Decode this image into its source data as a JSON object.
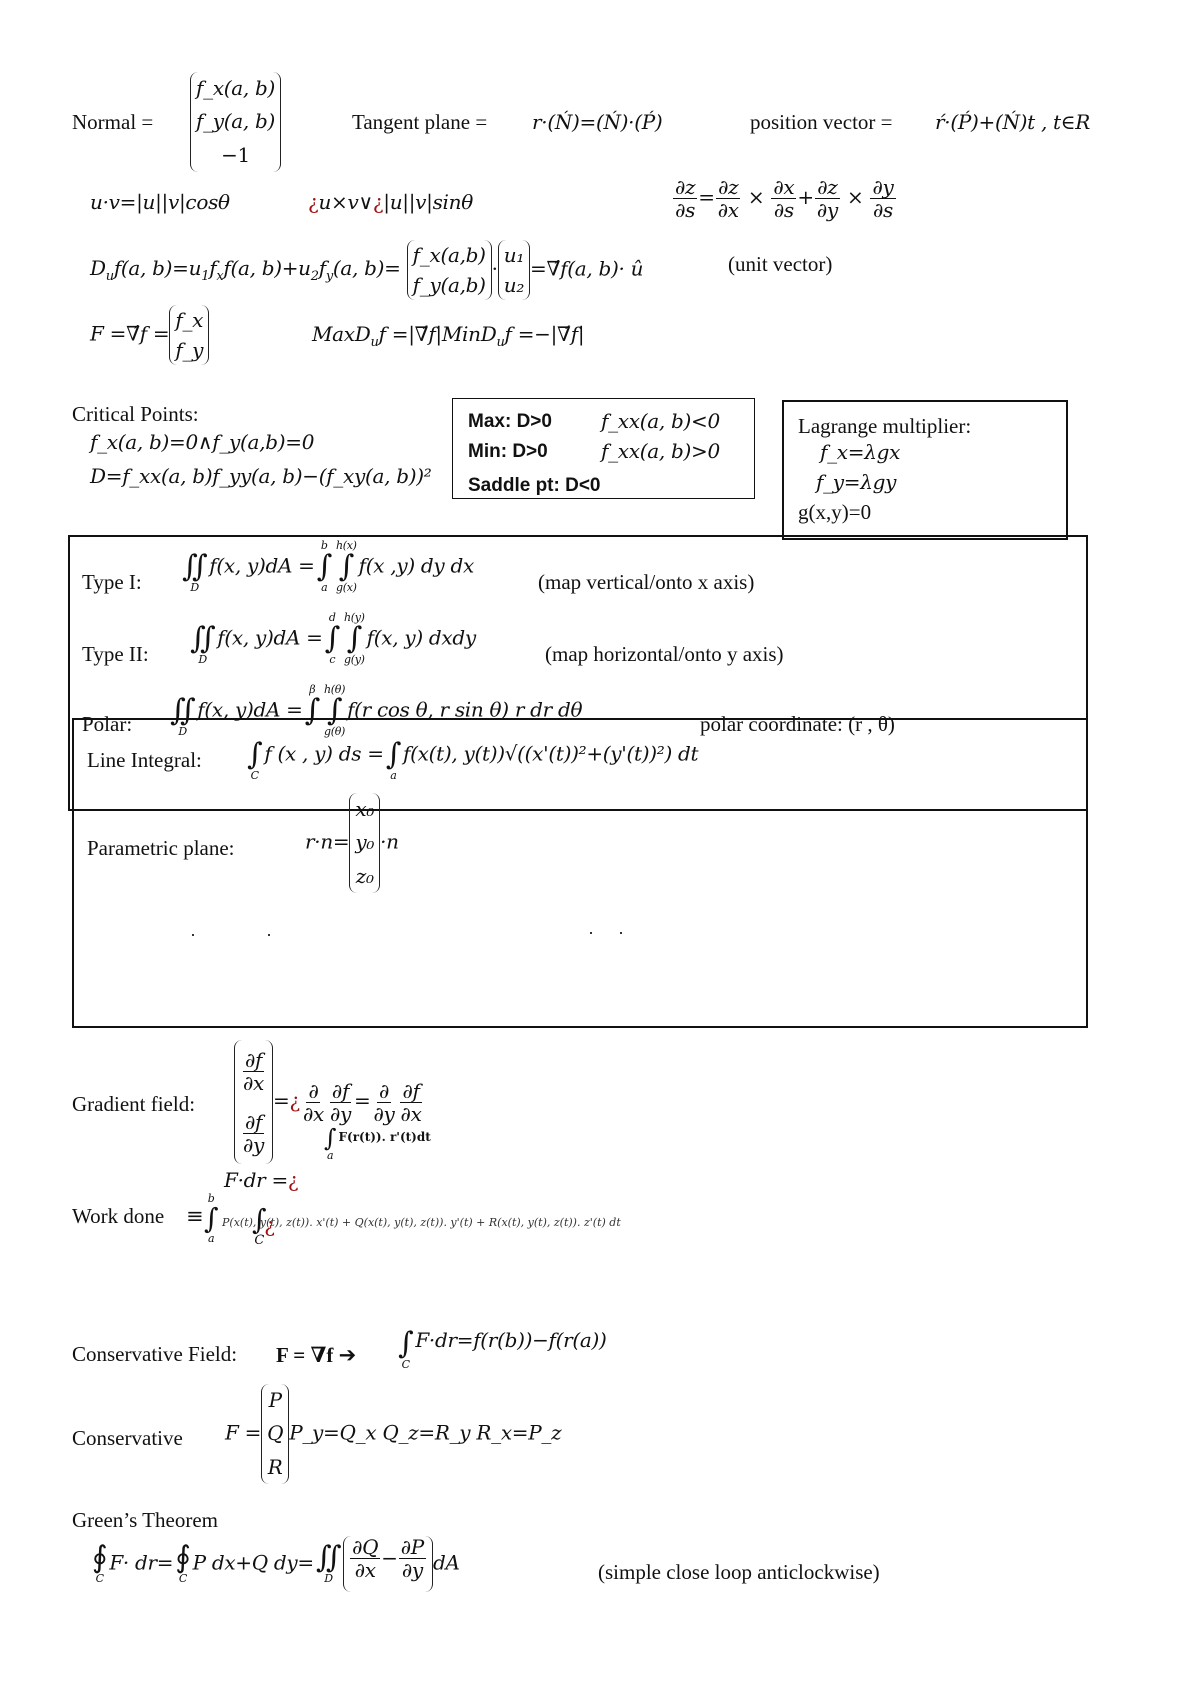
{
  "row1": {
    "normal_label": "Normal =",
    "normal_vector": [
      "f_x(a, b)",
      "f_y(a, b)",
      "−1"
    ],
    "tangent_label": "Tangent plane =",
    "tangent_expr": "r·(Ń)=(Ń)·(Ṕ)",
    "position_label": "position vector =",
    "position_expr": "ŕ·(Ṕ)+(Ń)t , t∈R"
  },
  "row2": {
    "dot_product": "u·v=|u||v|cosθ",
    "cross_product_mark1": "¿",
    "cross_product_mid": "u×v∨",
    "cross_product_mark2": "¿",
    "cross_product_end": "|u||v|sinθ",
    "chain_rule": {
      "lhs_num": "∂z",
      "lhs_den": "∂s",
      "t1_num": "∂z",
      "t1_den": "∂x",
      "t2_num": "∂x",
      "t2_den": "∂s",
      "t3_num": "∂z",
      "t3_den": "∂y",
      "t4_num": "∂y",
      "t4_den": "∂s"
    }
  },
  "directional": {
    "lhs": "D",
    "lhs_sub": "u",
    "lhs_rest": "f(a, b)=u",
    "expr_mid": "f",
    "expr_full": "f(a, b)+u",
    "expr_full2": "f",
    "expr_end": "(a, b)=",
    "vec1": [
      "f_x(a,b)",
      "f_y(a,b)"
    ],
    "vec2": [
      "u₁",
      "u₂"
    ],
    "rhs": "=∇́f(a, b)· û",
    "note": "(unit vector)"
  },
  "gradient": {
    "lhs": "F =∇́f =",
    "vec": [
      "f_x",
      "f_y"
    ],
    "maxmin": "MaxD",
    "max_sub": "u",
    "max_rest": "f =|∇́f|MinD",
    "min_sub": "u",
    "min_rest": "f =−|∇́f|"
  },
  "critical": {
    "title": "Critical Points:",
    "cond": "f_x(a, b)=0∧f_y(a,b)=0",
    "disc": "D=f_xx(a, b)f_yy(a, b)−(f_xy(a, b))²"
  },
  "classify_box": {
    "rows": [
      {
        "label": "Max: D>0",
        "cond": "f_xx(a, b)<0"
      },
      {
        "label": "Min: D>0",
        "cond": "f_xx(a, b)>0"
      },
      {
        "label": "Saddle pt: D<0",
        "cond": ""
      }
    ]
  },
  "lagrange_box": {
    "title": "Lagrange multiplier:",
    "eq1": "f_x=λgx",
    "eq2": "f_y=λgy",
    "eq3": "g(x,y)=0"
  },
  "double_integrals": {
    "type1": {
      "label": "Type I:",
      "lhs": "f(x, y)dA =",
      "outer_lo": "a",
      "outer_hi": "b",
      "inner_lo": "g(x)",
      "inner_hi": "h(x)",
      "integrand": "f(x ,y) dy dx",
      "note": "(map vertical/onto x axis)"
    },
    "type2": {
      "label": "Type II:",
      "lhs": "f(x, y)dA =",
      "outer_lo": "c",
      "outer_hi": "d",
      "inner_lo": "g(y)",
      "inner_hi": "h(y)",
      "integrand": "f(x, y) dxdy",
      "note": "(map horizontal/onto y axis)"
    },
    "polar": {
      "label": "Polar:",
      "lhs": "f(x, y)dA =",
      "outer_hi": "β",
      "inner_hi": "h(θ)",
      "outer_lo": "",
      "inner_lo": "g(θ)",
      "integrand": "f(r cos θ, r sin θ) r dr dθ",
      "note": "polar coordinate: (r , θ)"
    },
    "region": "D"
  },
  "line_integral": {
    "label": "Line Integral:",
    "lhs": "f (x , y) ds =",
    "lhs_lim": "C",
    "rhs_lim": "a",
    "rhs": "f(x(t), y(t))√((x'(t))²+(y'(t))²) dt"
  },
  "parametric_plane": {
    "label": "Parametric plane:",
    "lhs": "r·n=",
    "vec": [
      "x₀",
      "y₀",
      "z₀"
    ],
    "rhs": "·n"
  },
  "gradient_field": {
    "label": "Gradient field:",
    "vec_num1": "∂f",
    "vec_den1": "∂x",
    "vec_num2": "∂f",
    "vec_den2": "∂y",
    "mark": "¿",
    "eq1_a_num": "∂",
    "eq1_a_den": "∂x",
    "eq1_b_num": "∂f",
    "eq1_b_den": "∂y",
    "eq2_a_num": "∂",
    "eq2_a_den": "∂y",
    "eq2_b_num": "∂f",
    "eq2_b_den": "∂x",
    "work_integrand": "F(r(t)). r'(t)dt",
    "work_lim": "a",
    "f_dr": "F·dr =",
    "f_dr_mark": "¿"
  },
  "work_done": {
    "label": "Work done",
    "eq": "≡",
    "lim_hi": "b",
    "lim_lo": "a",
    "integrand": "P(x(t), y(t), z(t)). x'(t) + Q(x(t), y(t), z(t)). y'(t) + R(x(t), y(t), z(t)). z'(t)   dt",
    "overlay_lim": "C",
    "mark": "¿"
  },
  "conservative_field": {
    "label": "Conservative Field:",
    "expr": "F = ∇f",
    "arrow": "➔",
    "lim": "C",
    "rhs": "F·dr=f(r(b))−f(r(a))"
  },
  "conservative": {
    "label": "Conservative",
    "lhs": "F =",
    "vec": [
      "P",
      "Q",
      "R"
    ],
    "rhs": "P_y=Q_x Q_z=R_y R_x=P_z"
  },
  "greens": {
    "title": "Green’s Theorem",
    "lhs": "F· dr=",
    "mid": "P dx+Q dy=",
    "lim_c": "C",
    "lim_d": "D",
    "frac1_num": "∂Q",
    "frac1_den": "∂x",
    "frac2_num": "∂P",
    "frac2_den": "∂y",
    "end": "dA",
    "note": "(simple close loop anticlockwise)"
  }
}
